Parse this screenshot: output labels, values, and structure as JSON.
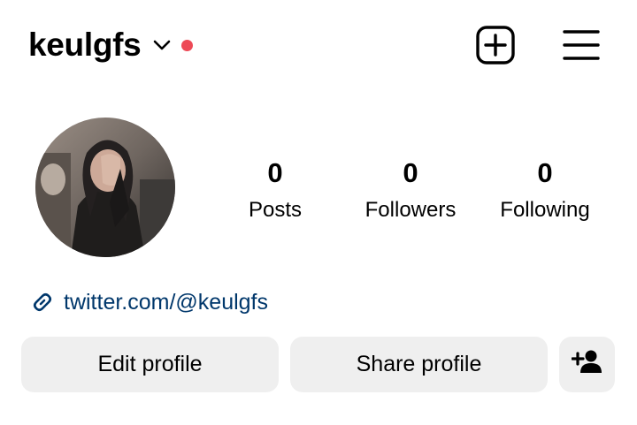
{
  "header": {
    "username": "keulgfs",
    "icons": {
      "dropdown": "chevron-down-icon",
      "notification": "notification-dot",
      "create": "plus-square-icon",
      "menu": "hamburger-menu-icon"
    }
  },
  "profile": {
    "avatar_alt": "profile-photo",
    "stats": [
      {
        "value": "0",
        "label": "Posts"
      },
      {
        "value": "0",
        "label": "Followers"
      },
      {
        "value": "0",
        "label": "Following"
      }
    ],
    "link": {
      "icon": "link-icon",
      "text": "twitter.com/@keulgfs"
    }
  },
  "actions": {
    "edit_label": "Edit profile",
    "share_label": "Share profile",
    "discover_icon": "add-person-icon"
  },
  "colors": {
    "notification_dot": "#ed4956",
    "link_text": "#00376b",
    "button_bg": "#efefef",
    "text": "#000000"
  }
}
